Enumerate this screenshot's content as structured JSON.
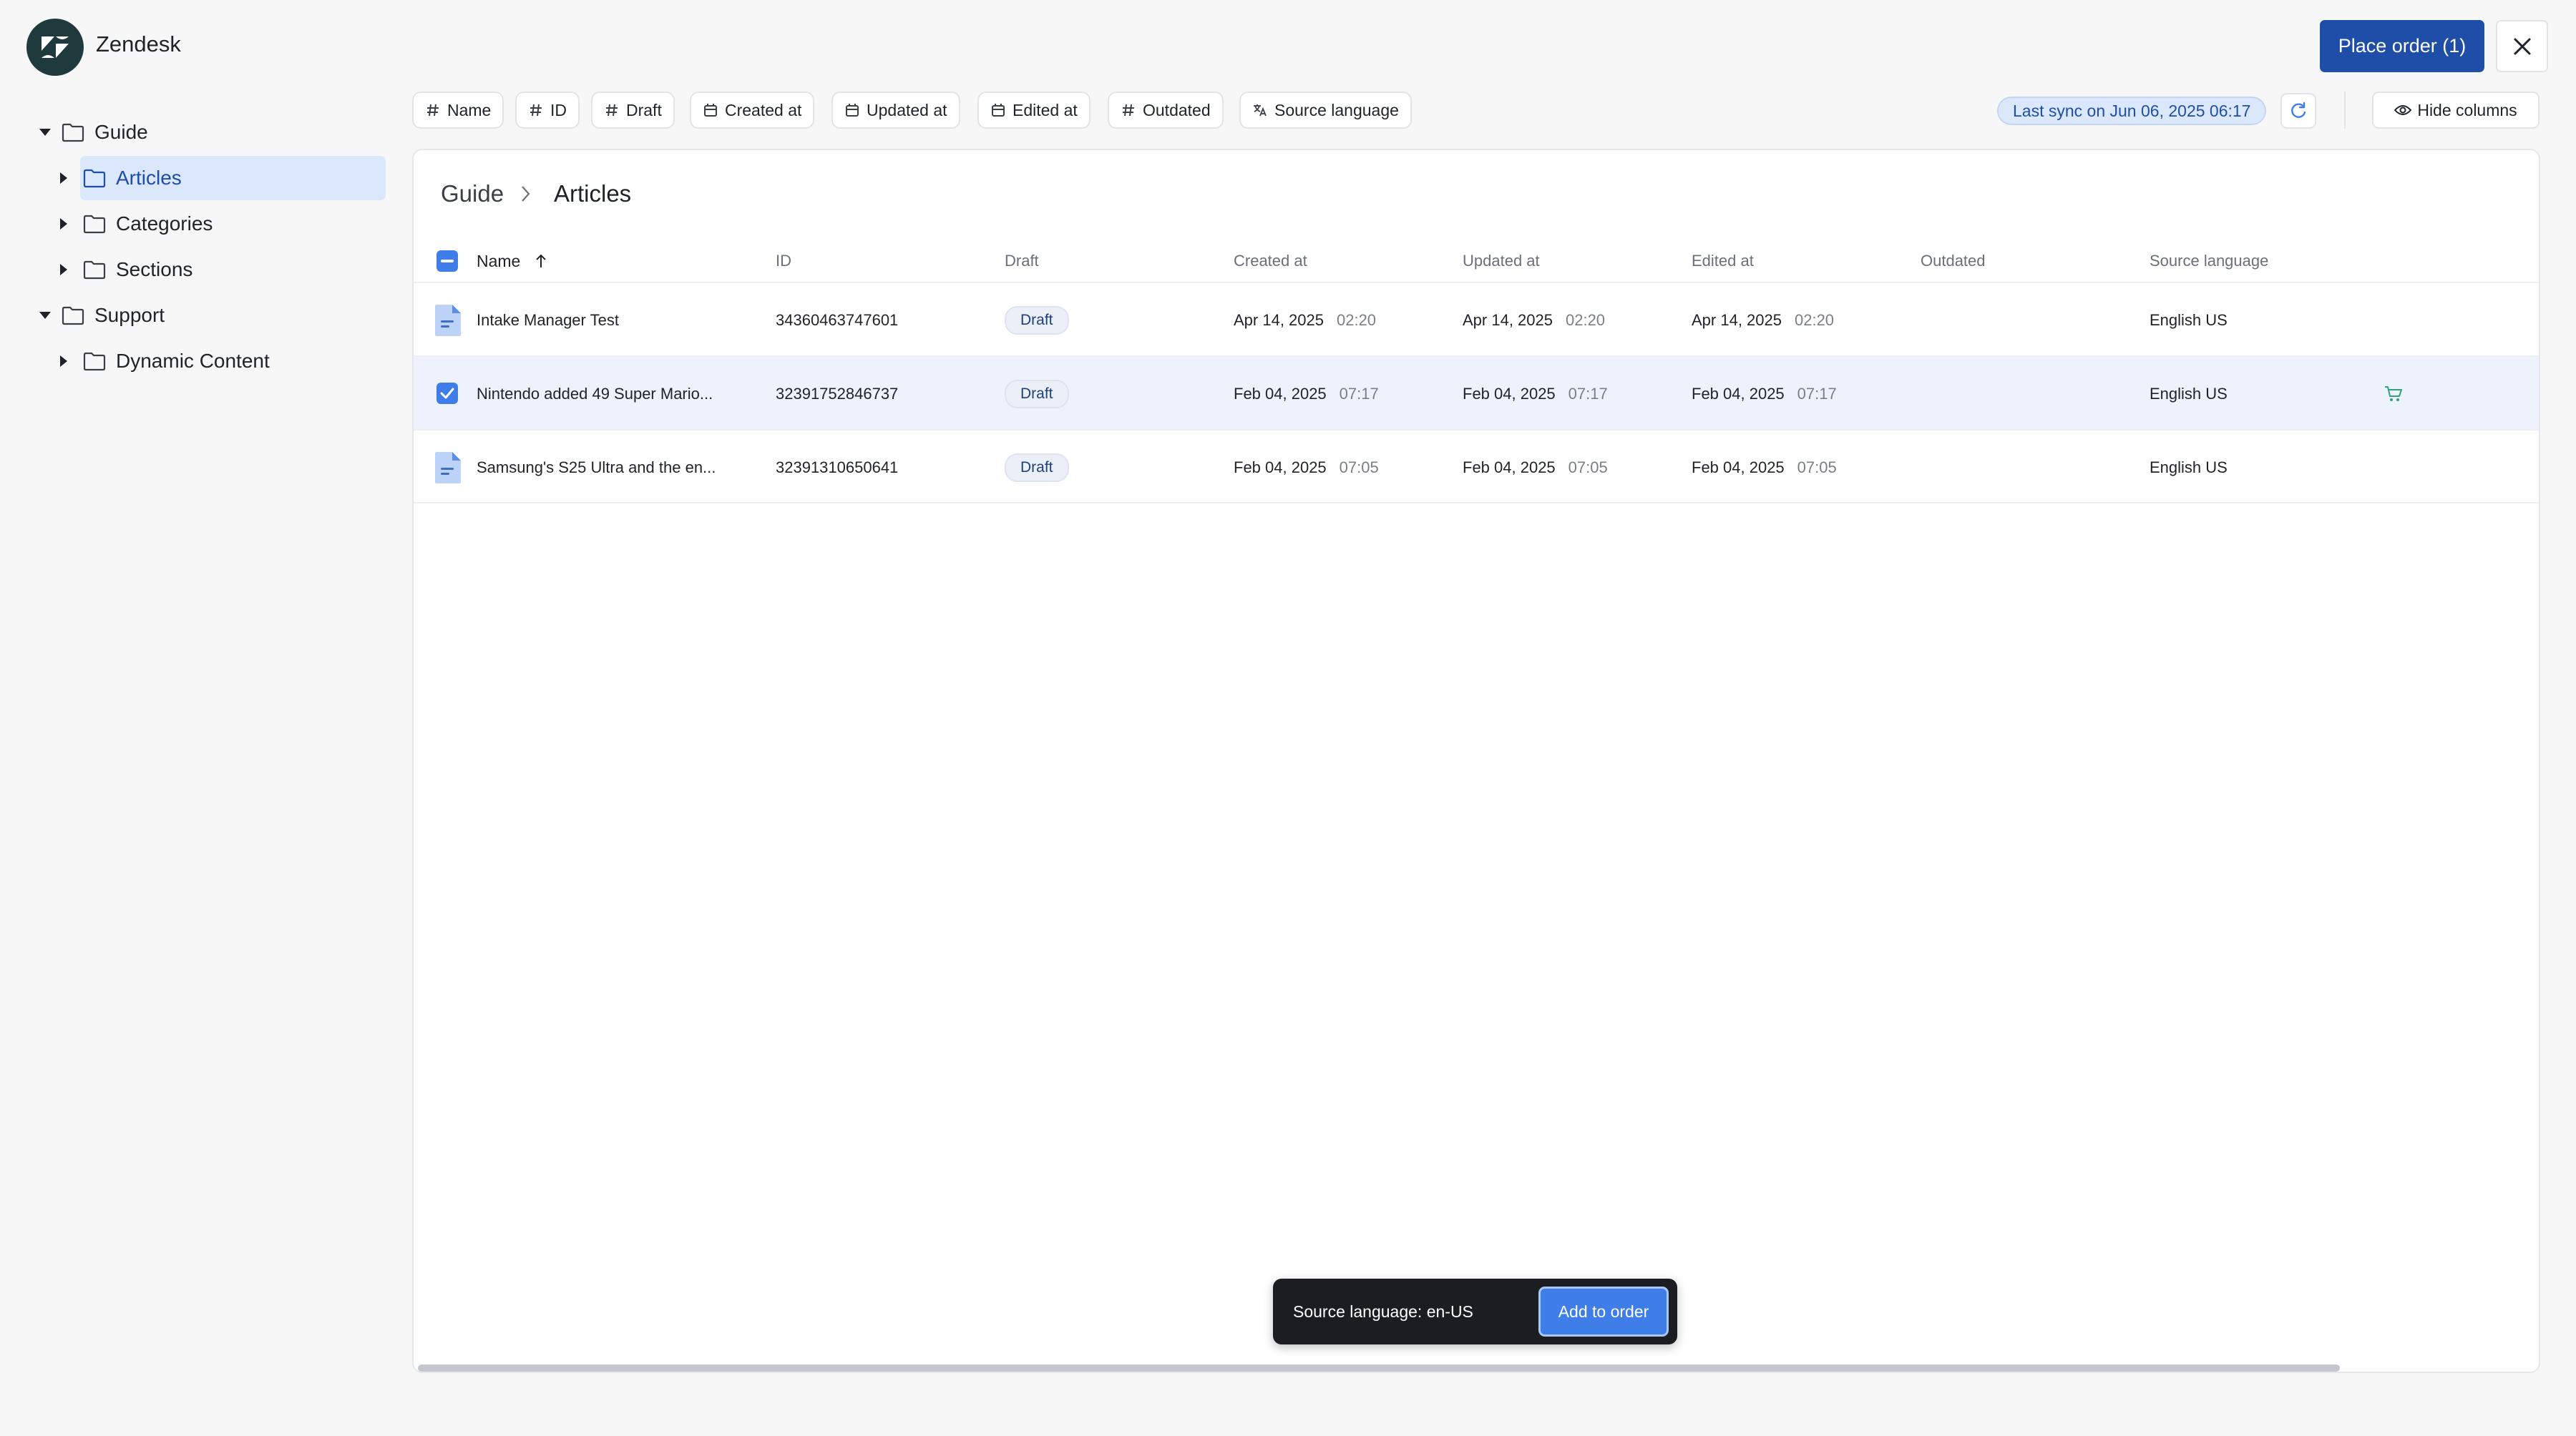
{
  "app": {
    "brand": "Zendesk",
    "place_order_label": "Place order (1)",
    "accent": "#1f4ea8",
    "primary": "#3f7ee8"
  },
  "sidebar": {
    "items": [
      {
        "label": "Guide",
        "expanded": true
      },
      {
        "label": "Articles",
        "selected": true
      },
      {
        "label": "Categories"
      },
      {
        "label": "Sections"
      },
      {
        "label": "Support",
        "expanded": true
      },
      {
        "label": "Dynamic Content"
      }
    ]
  },
  "toolbar": {
    "chips": [
      {
        "label": "Name",
        "icon": "hash-icon"
      },
      {
        "label": "ID",
        "icon": "hash-icon"
      },
      {
        "label": "Draft",
        "icon": "hash-icon"
      },
      {
        "label": "Created at",
        "icon": "calendar-icon"
      },
      {
        "label": "Updated at",
        "icon": "calendar-icon"
      },
      {
        "label": "Edited at",
        "icon": "calendar-icon"
      },
      {
        "label": "Outdated",
        "icon": "hash-icon"
      },
      {
        "label": "Source language",
        "icon": "translate-icon"
      }
    ],
    "sync_label": "Last sync on Jun 06, 2025 06:17",
    "hide_columns_label": "Hide columns"
  },
  "breadcrumb": {
    "root": "Guide",
    "current": "Articles"
  },
  "table": {
    "headers": {
      "name": "Name",
      "id": "ID",
      "draft": "Draft",
      "created": "Created at",
      "updated": "Updated at",
      "edited": "Edited at",
      "outdated": "Outdated",
      "source_language": "Source language"
    },
    "sort": "ascending",
    "rows": [
      {
        "name": "Intake Manager Test",
        "id": "34360463747601",
        "draft": "Draft",
        "created_date": "Apr 14, 2025",
        "created_time": "02:20",
        "updated_date": "Apr 14, 2025",
        "updated_time": "02:20",
        "edited_date": "Apr 14, 2025",
        "edited_time": "02:20",
        "outdated": "",
        "source_language": "English US",
        "checked": false
      },
      {
        "name": "Nintendo added 49 Super Mario...",
        "id": "32391752846737",
        "draft": "Draft",
        "created_date": "Feb 04, 2025",
        "created_time": "07:17",
        "updated_date": "Feb 04, 2025",
        "updated_time": "07:17",
        "edited_date": "Feb 04, 2025",
        "edited_time": "07:17",
        "outdated": "",
        "source_language": "English US",
        "checked": true,
        "in_cart": true
      },
      {
        "name": "Samsung's S25 Ultra and the en...",
        "id": "32391310650641",
        "draft": "Draft",
        "created_date": "Feb 04, 2025",
        "created_time": "07:05",
        "updated_date": "Feb 04, 2025",
        "updated_time": "07:05",
        "edited_date": "Feb 04, 2025",
        "edited_time": "07:05",
        "outdated": "",
        "source_language": "English US",
        "checked": false
      }
    ]
  },
  "toast": {
    "text": "Source language: en-US",
    "button_label": "Add to order"
  }
}
